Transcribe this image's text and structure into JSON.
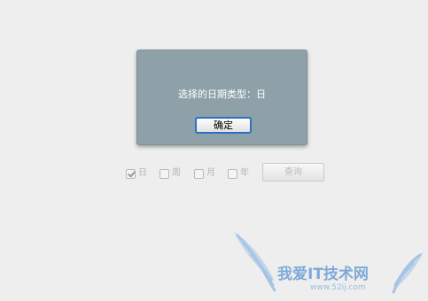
{
  "dialog": {
    "message": "选择的日期类型：日",
    "ok_label": "确定"
  },
  "filters": {
    "options": [
      {
        "label": "日",
        "checked": true
      },
      {
        "label": "周",
        "checked": false
      },
      {
        "label": "月",
        "checked": false
      },
      {
        "label": "年",
        "checked": false
      }
    ],
    "query_label": "查询"
  },
  "watermark": {
    "text": "我爱IT技术网",
    "url": "www.52ij.com"
  },
  "colors": {
    "dialog_bg": "#8fa1a8",
    "ok_border": "#2b6fc9",
    "watermark": "#7ea9d8"
  }
}
